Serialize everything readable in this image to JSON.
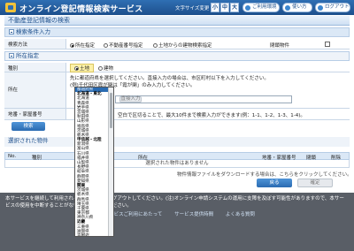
{
  "header": {
    "title": "オンライン登記情報検索サービス",
    "font_size_label": "文字サイズ変更",
    "font_sizes": [
      "小",
      "中",
      "大"
    ],
    "manual_label": "ご利用環境",
    "help_label": "使い方",
    "logout_label": "ログアウト"
  },
  "page": {
    "title": "不動産登記情報の検索"
  },
  "search": {
    "section_title": "検索条件入力",
    "method_label": "検索方法",
    "methods": [
      "所在指定",
      "不動産番号指定",
      "土地からの建物検索指定"
    ],
    "closed_label": "閉鎖物件",
    "location_section": "所在指定",
    "type_label": "種別",
    "types": [
      "土地",
      "建物"
    ],
    "location_label": "所在",
    "location_hint1": "先に都道府県を選択してください。直接入力の場合は、市区町村以下を入力してください。",
    "location_hint2": "(例)千代田区霞が関は「霞が関」のみ入力してください。",
    "input_label": "直接入力",
    "lot_label": "地番・家屋番号",
    "lot_hint": "空白で区切ることで、最大10件まで検索入力ができます(例：1-1、1-2、1-3、1-4)。",
    "search_button": "検索"
  },
  "dropdown": {
    "items": [
      {
        "label": "都道府県",
        "kind": "selected"
      },
      {
        "label": "北海道・東北",
        "kind": "group"
      },
      {
        "label": "北海道",
        "kind": "item"
      },
      {
        "label": "青森県",
        "kind": "item"
      },
      {
        "label": "岩手県",
        "kind": "item"
      },
      {
        "label": "宮城県",
        "kind": "item"
      },
      {
        "label": "秋田県",
        "kind": "item"
      },
      {
        "label": "山形県",
        "kind": "item"
      },
      {
        "label": "福島県",
        "kind": "item"
      },
      {
        "label": "茨城県",
        "kind": "item"
      },
      {
        "label": "栃木県",
        "kind": "item"
      },
      {
        "label": "甲信越・北陸",
        "kind": "group"
      },
      {
        "label": "新潟県",
        "kind": "item"
      },
      {
        "label": "富山県",
        "kind": "item"
      },
      {
        "label": "石川県",
        "kind": "item"
      },
      {
        "label": "福井県",
        "kind": "item"
      },
      {
        "label": "山梨県",
        "kind": "item"
      },
      {
        "label": "長野県",
        "kind": "item"
      },
      {
        "label": "岐阜県",
        "kind": "item"
      },
      {
        "label": "静岡県",
        "kind": "item"
      },
      {
        "label": "愛知県",
        "kind": "item"
      },
      {
        "label": "関東",
        "kind": "group"
      },
      {
        "label": "茨城県",
        "kind": "item"
      },
      {
        "label": "栃木県",
        "kind": "item"
      },
      {
        "label": "群馬県",
        "kind": "item"
      },
      {
        "label": "埼玉県",
        "kind": "item"
      },
      {
        "label": "千葉県",
        "kind": "item"
      },
      {
        "label": "東京都",
        "kind": "item"
      },
      {
        "label": "神奈川県",
        "kind": "item"
      },
      {
        "label": "近畿",
        "kind": "group"
      },
      {
        "label": "三重県",
        "kind": "item"
      },
      {
        "label": "滋賀県",
        "kind": "item"
      },
      {
        "label": "京都府",
        "kind": "item"
      },
      {
        "label": "大阪府",
        "kind": "item"
      }
    ]
  },
  "selected": {
    "section_title": "選択された物件",
    "columns": [
      "No.",
      "種別",
      "所在",
      "地番・家屋番号",
      "閉鎖",
      "削除"
    ],
    "empty_text": "選択された物件はありません",
    "note": "物件情報ファイルをダウンロードする場合は、こちらをクリックしてください。",
    "back_button": "戻る",
    "next_button": "確定"
  },
  "footer": {
    "notice": "本サービスを継続して利用される場合は、必ずログアウトしてください。(注)オンライン申請システムの運用に支障を及ぼす可能性がありますので、本サービスの使用を中断することがないようにご注意ください。",
    "links": [
      "本サービスご利用にあたって",
      "サービス提供時間",
      "よくある質問"
    ]
  }
}
